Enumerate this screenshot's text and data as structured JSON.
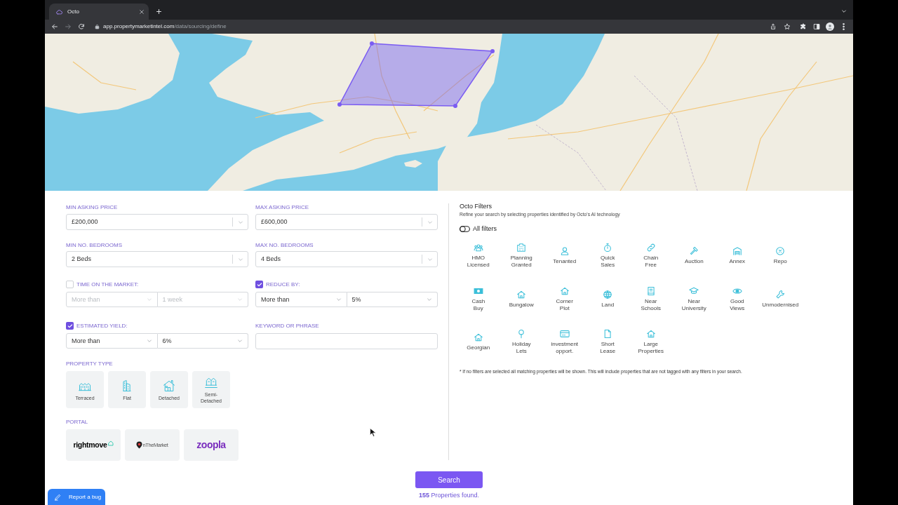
{
  "browser": {
    "tab_title": "Octo",
    "url": {
      "host": "app.propertymarketintel.com",
      "path": "/data/sourcing/define"
    }
  },
  "search_form": {
    "selects": [
      {
        "label": "MIN ASKING PRICE",
        "value": "£200,000"
      },
      {
        "label": "MAX ASKING PRICE",
        "value": "£600,000"
      },
      {
        "label": "MIN NO. BEDROOMS",
        "value": "2 Beds"
      },
      {
        "label": "MAX NO. BEDROOMS",
        "value": "4 Beds"
      }
    ],
    "conditions": [
      {
        "label": "TIME ON THE MARKET:",
        "checked": false,
        "operator": "More than",
        "amount": "1 week"
      },
      {
        "label": "REDUCE BY:",
        "checked": true,
        "operator": "More than",
        "amount": "5%"
      },
      {
        "label": "ESTIMATED YIELD:",
        "checked": true,
        "operator": "More than",
        "amount": "6%"
      }
    ],
    "keyword": {
      "label": "KEYWORD OR PHRASE"
    },
    "property_type": {
      "label": "PROPERTY TYPE",
      "options": [
        {
          "label": "Terraced"
        },
        {
          "label": "Flat"
        },
        {
          "label": "Detached"
        },
        {
          "label": "Semi-Detached"
        }
      ]
    },
    "portal": {
      "label": "PORTAL",
      "options": [
        {
          "logo_text": "rightmove"
        },
        {
          "logo_text": "nTheMarket"
        },
        {
          "logo_text": "zoopla"
        }
      ]
    }
  },
  "octo_filters": {
    "title": "Octo Filters",
    "subtitle": "Refine your search by selecting properties identified by Octo's AI technology",
    "all_filters": {
      "label": "All filters",
      "on": false
    },
    "options": [
      {
        "label": "HMO Licensed"
      },
      {
        "label": "Planning Granted"
      },
      {
        "label": "Tenanted"
      },
      {
        "label": "Quick Sales"
      },
      {
        "label": "Chain Free"
      },
      {
        "label": "Auction"
      },
      {
        "label": "Annex"
      },
      {
        "label": "Repo"
      },
      {
        "label": "Cash Buy"
      },
      {
        "label": "Bungalow"
      },
      {
        "label": "Corner Plot"
      },
      {
        "label": "Land"
      },
      {
        "label": "Near Schools"
      },
      {
        "label": "Near University"
      },
      {
        "label": "Good Views"
      },
      {
        "label": "Unmodernised"
      },
      {
        "label": "Georgian"
      },
      {
        "label": "Holiday Lets"
      },
      {
        "label": "investment opport."
      },
      {
        "label": "Short Lease"
      },
      {
        "label": "Large Properties"
      }
    ],
    "note": "* If no filters are selected all matching properties will be shown. This will include properties that are not tagged with any filters in your search."
  },
  "search": {
    "button": "Search",
    "result": "**155** Properties found."
  },
  "report_bug": {
    "label": "Report a bug"
  }
}
